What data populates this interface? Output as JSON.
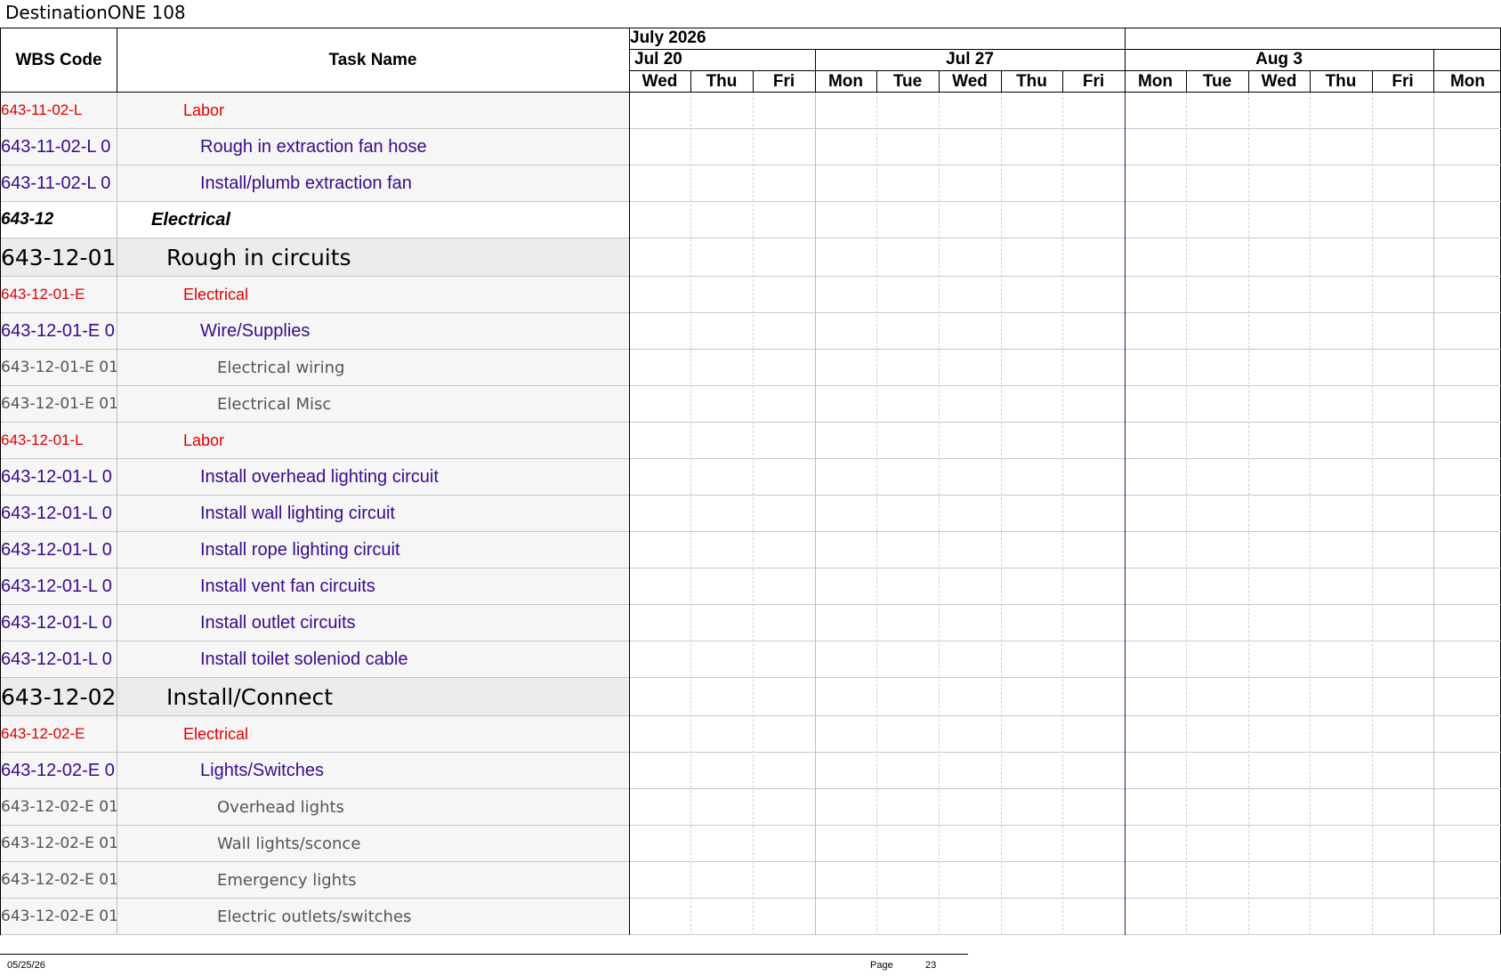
{
  "title": "DestinationONE 108",
  "columns": {
    "wbs": "WBS Code",
    "task": "Task Name"
  },
  "timeline": {
    "month": "July 2026",
    "weeks": [
      "Jul 20",
      "Jul 27",
      "Aug 3"
    ],
    "days": [
      "Wed",
      "Thu",
      "Fri",
      "Mon",
      "Tue",
      "Wed",
      "Thu",
      "Fri",
      "Mon",
      "Tue",
      "Wed",
      "Thu",
      "Fri",
      "Mon"
    ]
  },
  "rows": [
    {
      "wbs": "643-11-02-L",
      "task": "Labor",
      "style": "red"
    },
    {
      "wbs": "643-11-02-L 0",
      "task": "Rough in extraction fan hose",
      "style": "purple"
    },
    {
      "wbs": "643-11-02-L 0",
      "task": "Install/plumb extraction fan",
      "style": "purple"
    },
    {
      "wbs": "643-12",
      "task": "Electrical",
      "style": "bold"
    },
    {
      "wbs": "643-12-01",
      "task": "Rough in circuits",
      "style": "large"
    },
    {
      "wbs": "643-12-01-E",
      "task": "Electrical",
      "style": "red"
    },
    {
      "wbs": "643-12-01-E 0",
      "task": "Wire/Supplies",
      "style": "purple"
    },
    {
      "wbs": "643-12-01-E 01",
      "task": "Electrical wiring",
      "style": "gray"
    },
    {
      "wbs": "643-12-01-E 01",
      "task": "Electrical Misc",
      "style": "gray"
    },
    {
      "wbs": "643-12-01-L",
      "task": "Labor",
      "style": "red"
    },
    {
      "wbs": "643-12-01-L 0",
      "task": "Install overhead lighting circuit",
      "style": "purple"
    },
    {
      "wbs": "643-12-01-L 0",
      "task": "Install wall lighting circuit",
      "style": "purple"
    },
    {
      "wbs": "643-12-01-L 0",
      "task": "Install rope lighting circuit",
      "style": "purple"
    },
    {
      "wbs": "643-12-01-L 0",
      "task": "Install vent fan circuits",
      "style": "purple"
    },
    {
      "wbs": "643-12-01-L 0",
      "task": "Install outlet circuits",
      "style": "purple"
    },
    {
      "wbs": "643-12-01-L 0",
      "task": "Install toilet soleniod cable",
      "style": "purple"
    },
    {
      "wbs": "643-12-02",
      "task": "Install/Connect",
      "style": "large"
    },
    {
      "wbs": "643-12-02-E",
      "task": "Electrical",
      "style": "red"
    },
    {
      "wbs": "643-12-02-E 0",
      "task": "Lights/Switches",
      "style": "purple"
    },
    {
      "wbs": "643-12-02-E 01",
      "task": "Overhead lights",
      "style": "gray"
    },
    {
      "wbs": "643-12-02-E 01",
      "task": "Wall lights/sconce",
      "style": "gray"
    },
    {
      "wbs": "643-12-02-E 01",
      "task": "Emergency lights",
      "style": "gray"
    },
    {
      "wbs": "643-12-02-E 01",
      "task": "Electric outlets/switches",
      "style": "gray"
    }
  ],
  "footer": {
    "date": "05/25/26",
    "page_label": "Page",
    "page_number": "23"
  }
}
